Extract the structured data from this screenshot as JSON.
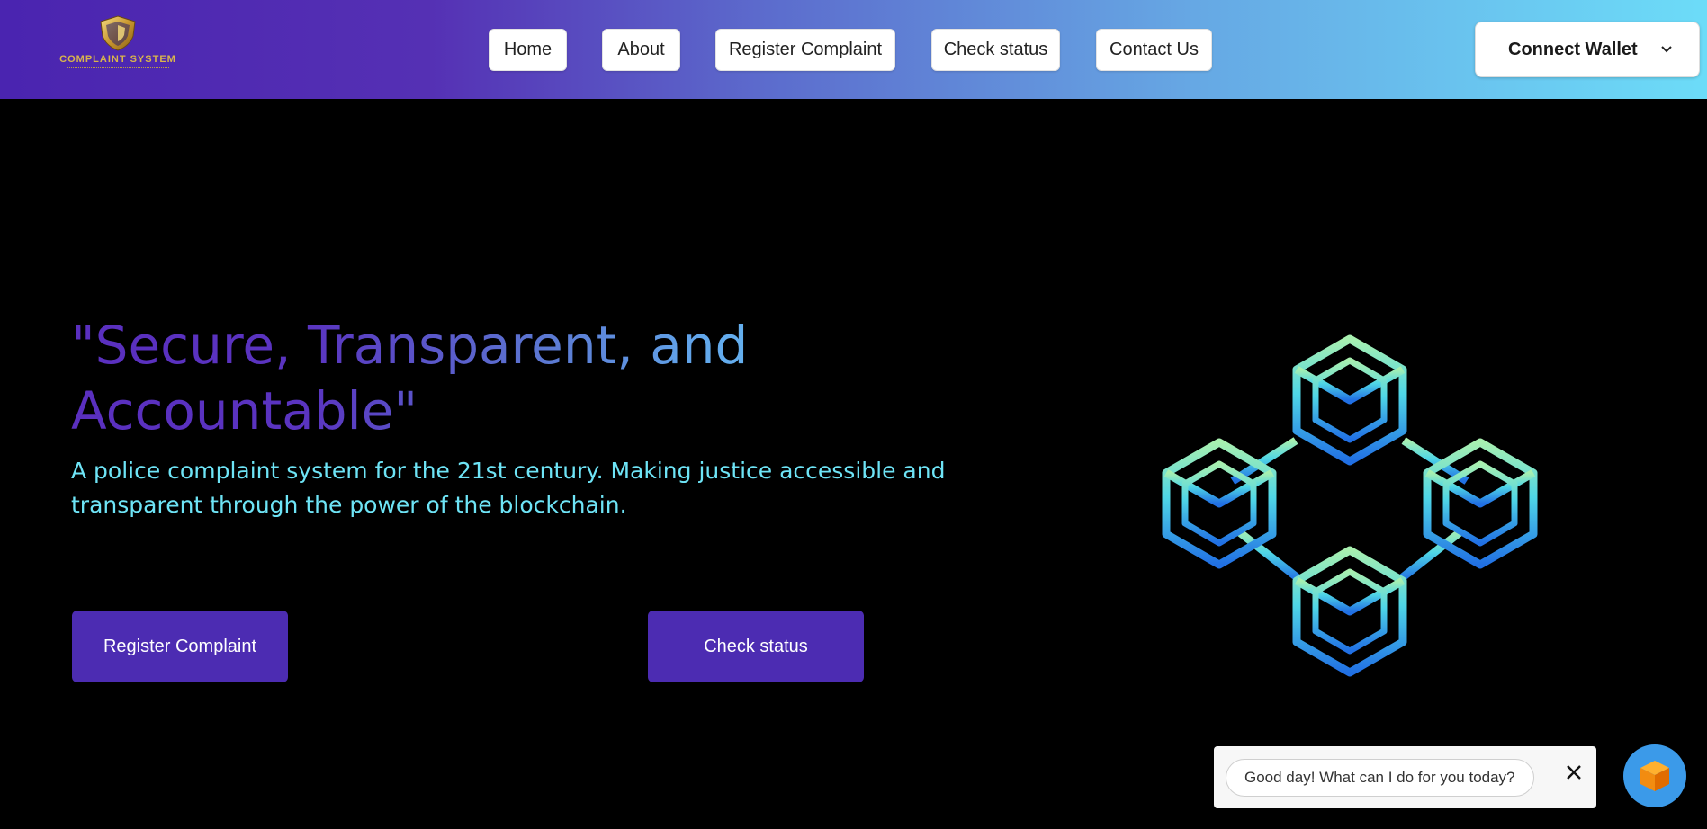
{
  "header": {
    "logo": {
      "title": "COMPLAINT SYSTEM",
      "icon": "shield-icon"
    },
    "nav": [
      {
        "label": "Home"
      },
      {
        "label": "About"
      },
      {
        "label": "Register Complaint"
      },
      {
        "label": "Check status"
      },
      {
        "label": "Contact Us"
      }
    ],
    "wallet_button": {
      "label": "Connect Wallet",
      "icon": "chevron-down-icon"
    }
  },
  "hero": {
    "title": "\"Secure, Transparent, and Accountable\"",
    "subtitle": "A police complaint system for the 21st century. Making justice accessible and transparent through the power of the blockchain.",
    "primary_button": "Register Complaint",
    "secondary_button": "Check status",
    "graphic_icon": "blockchain-cubes-icon"
  },
  "chat": {
    "message": "Good day! What can I do for you today?",
    "close_icon": "close-icon",
    "launcher_icon": "cube-icon"
  },
  "colors": {
    "header_gradient_start": "#4a24b0",
    "header_gradient_end": "#6cdcf8",
    "hero_subtitle": "#6ee4f6",
    "cta_background": "#4c2cb2",
    "chat_launcher": "#3b9ae9"
  }
}
